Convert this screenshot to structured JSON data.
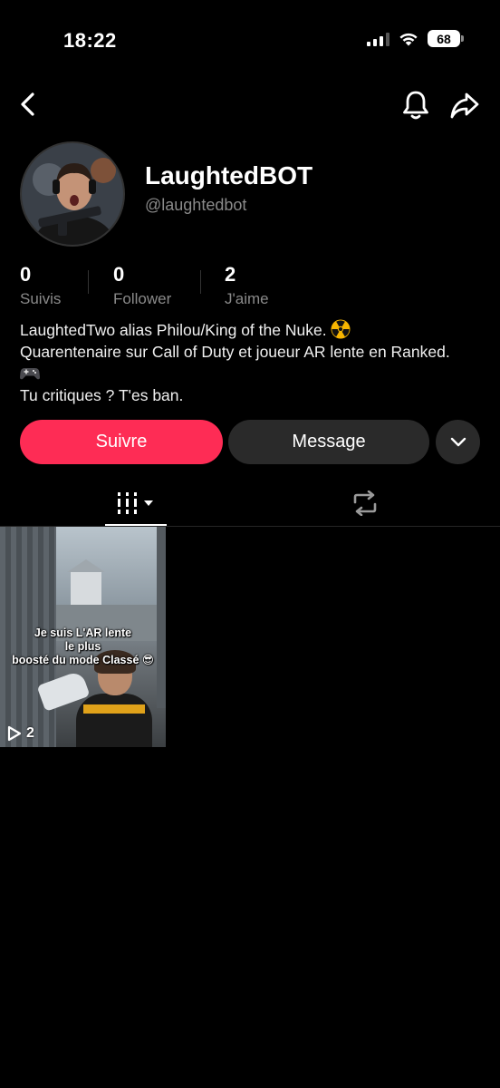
{
  "status_bar": {
    "time": "18:22",
    "battery": "68",
    "icons": [
      "cellular-signal-icon",
      "wifi-icon",
      "battery-icon"
    ]
  },
  "nav": {
    "icons": [
      "back-chevron-icon",
      "bell-icon",
      "share-arrow-icon"
    ]
  },
  "profile": {
    "display_name": "LaughtedBOT",
    "handle": "@laughtedbot",
    "stats": [
      {
        "value": "0",
        "label": "Suivis"
      },
      {
        "value": "0",
        "label": "Follower"
      },
      {
        "value": "2",
        "label": "J'aime"
      }
    ],
    "bio": {
      "line1": "LaughtedTwo alias Philou/King of the Nuke.",
      "line1_emoji": "radioactive-emoji",
      "line2": "Quarentenaire sur Call of Duty et joueur AR lente en Ranked.",
      "line3_emoji": "game-controller-emoji",
      "line4": "Tu critiques ? T'es ban."
    }
  },
  "actions": {
    "follow": "Suivre",
    "message": "Message",
    "more_icon": "chevron-down-icon"
  },
  "colors": {
    "accent": "#fe2c55",
    "background": "#000000",
    "secondary_button": "#2a2a2a",
    "muted_text": "#8a8a8a"
  },
  "tabs": [
    {
      "name": "videos",
      "icon": "grid-columns-icon",
      "selected": true
    },
    {
      "name": "reposts",
      "icon": "repost-icon",
      "selected": false
    }
  ],
  "videos": [
    {
      "caption_lines": [
        "Je suis L'AR lente",
        "le plus",
        "boosté du mode Classé 😎"
      ],
      "plays": "2"
    }
  ]
}
